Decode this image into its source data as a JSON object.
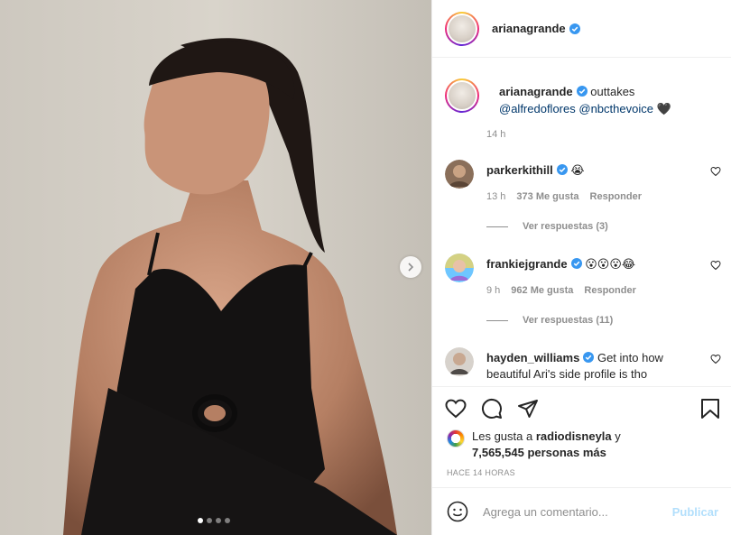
{
  "post": {
    "username": "arianagrande",
    "verified": true
  },
  "caption": {
    "username": "arianagrande",
    "text": "outtakes",
    "mentions": [
      "@alfredoflores",
      "@nbcthevoice"
    ],
    "emoji": "🖤",
    "time": "14 h"
  },
  "comments": [
    {
      "username": "parkerkithill",
      "text_emoji": "😭",
      "time": "13 h",
      "likes": "373 Me gusta",
      "reply_label": "Responder",
      "view_replies": "Ver respuestas (3)"
    },
    {
      "username": "frankiejgrande",
      "text_emoji": "😮😮😮😂",
      "time": "9 h",
      "likes": "962 Me gusta",
      "reply_label": "Responder",
      "view_replies": "Ver respuestas (11)"
    },
    {
      "username": "hayden_williams",
      "text": "Get into how beautiful Ari's side profile is tho"
    }
  ],
  "likes": {
    "prefix": "Les gusta a",
    "user": "radiodisneyla",
    "and": "y",
    "count": "7,565,545 personas más"
  },
  "ago": "HACE 14 HORAS",
  "compose": {
    "placeholder": "Agrega un comentario...",
    "publish": "Publicar"
  },
  "carousel": {
    "total": 4,
    "active": 1
  },
  "icons": {
    "like": "heart-icon",
    "comment": "comment-icon",
    "share": "paper-plane-icon",
    "save": "bookmark-icon",
    "emoji": "smiley-icon",
    "next": "chevron-right-icon",
    "more": "more-horizontal-icon",
    "verified": "verified-badge-icon"
  },
  "colors": {
    "verified": "#3897f0",
    "link": "#00376b",
    "muted": "#8e8e8e",
    "publish_disabled": "#b2dffc"
  }
}
